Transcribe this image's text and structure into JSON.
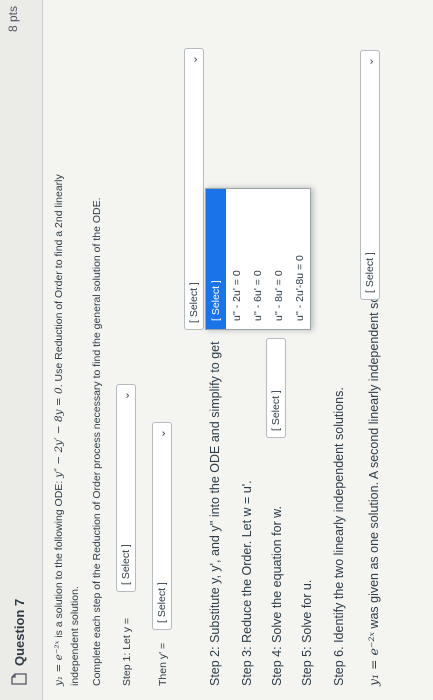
{
  "header": {
    "title": "Question 7",
    "points": "8 pts"
  },
  "problem": {
    "y1_expr": "y₁ = e⁻²ˣ",
    "line1": "is a solution to the following ODE:",
    "ode": "y″ − 2y′ − 8y = 0",
    "line1b": ". Use Reduction of Order to find a 2nd linearly",
    "line2": "independent solution.",
    "line3": "Complete each step of the Reduction of Order process necessary to find the general solution of the ODE."
  },
  "steps": {
    "step1_label": "Step 1: Let y =",
    "step1_select": "[ Select ]",
    "then_label": "Then y' =",
    "then_select": "[ Select ]",
    "step2_label": "Step 2: Substitute y, y', and y'' into the ODE and simplify to get",
    "step2_select": "[ Select ]",
    "step3_label": "Step 3: Reduce the Order. Let w = u'.",
    "step4_label": "Step 4: Solve the equation for w.",
    "step4_select": "[ Select ]",
    "step5_label": "Step 5: Solve for u.",
    "step6_label": "Step 6. Identify the two linearly independent solutions.",
    "final_label_expr": "y₁ = e⁻²ˣ",
    "final_label": "was given as one solution. A second linearly independent solution is",
    "final_select": "[ Select ]"
  },
  "dropdown": {
    "options": [
      "[ Select ]",
      "u'' - 2u' = 0",
      "u'' - 6u' = 0",
      "u'' - 8u' = 0",
      "u'' - 2u'-8u = 0"
    ],
    "active_index": 0
  },
  "colors": {
    "accent": "#1a73e8",
    "text": "#2d3b45"
  },
  "icons": {
    "question": "page-icon",
    "chevron": "chevron-down-icon"
  }
}
